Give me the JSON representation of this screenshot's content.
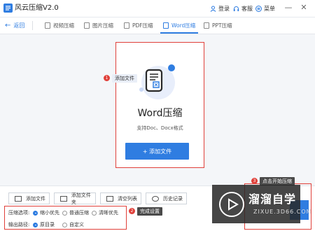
{
  "app": {
    "title": "风云压缩V2.0"
  },
  "titlebar": {
    "login": "登录",
    "service": "客服",
    "menu": "菜单"
  },
  "nav": {
    "back": "返回",
    "tabs": [
      {
        "label": "视频压缩",
        "active": false
      },
      {
        "label": "图片压缩",
        "active": false
      },
      {
        "label": "PDF压缩",
        "active": false
      },
      {
        "label": "Word压缩",
        "active": true
      },
      {
        "label": "PPT压缩",
        "active": false
      }
    ]
  },
  "main": {
    "title": "Word压缩",
    "subtitle": "支持Doc、Docx格式",
    "add_button": "+ 添加文件"
  },
  "annotations": [
    {
      "num": "1",
      "text": "添加文件"
    },
    {
      "num": "2",
      "text": "完成设置"
    },
    {
      "num": "3",
      "text": "点击开始压缩"
    }
  ],
  "toolbar": {
    "add_file": "添加文件",
    "add_folder": "添加文件夹",
    "clear_list": "清空列表",
    "history": "历史记录"
  },
  "options": {
    "compress_label": "压缩选项:",
    "compress_choices": [
      {
        "label": "缩小优先",
        "checked": true
      },
      {
        "label": "普通压缩",
        "checked": false
      },
      {
        "label": "清晰优先",
        "checked": false
      }
    ],
    "output_label": "输出路径:",
    "output_choices": [
      {
        "label": "原目录",
        "checked": true
      },
      {
        "label": "自定义",
        "checked": false
      }
    ]
  },
  "watermark": {
    "text": "溜溜自学",
    "url": "ZIXUE.3D66.COM"
  },
  "colors": {
    "accent": "#2f7de1",
    "annotation_red": "#e0403a"
  }
}
